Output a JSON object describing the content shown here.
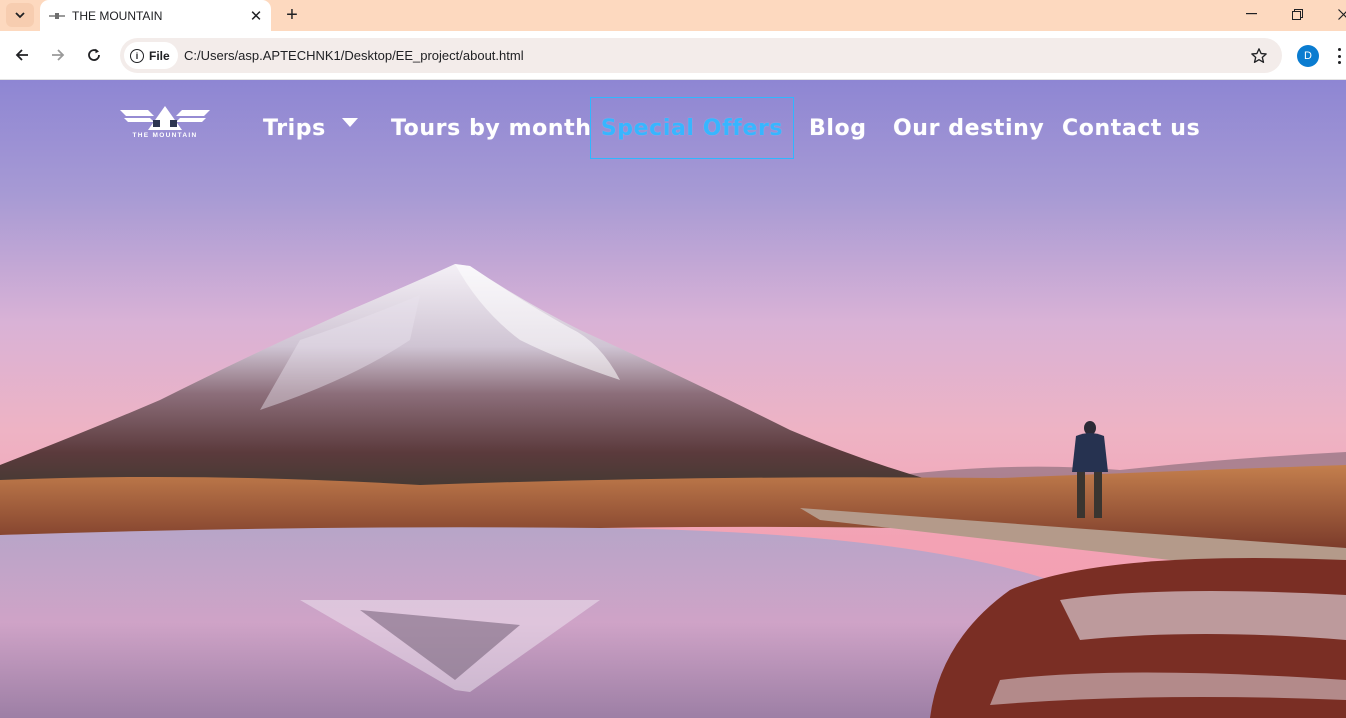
{
  "browser": {
    "tab_title": "THE MOUNTAIN",
    "tab_close": "✕",
    "new_tab": "+",
    "address_chip": "File",
    "url": "C:/Users/asp.APTECHNK1/Desktop/EE_project/about.html",
    "profile_initial": "D"
  },
  "site": {
    "logo_text": "THE MOUNTAIN",
    "nav": {
      "trips": "Trips",
      "tours": "Tours by month",
      "offers": "Special Offers",
      "blog": "Blog",
      "destiny": "Our destiny",
      "contact": "Contact us"
    },
    "active_nav": "Special Offers",
    "accent_color": "#2fb7ff"
  },
  "icons": [
    "tab-search-icon",
    "close-icon",
    "plus-icon",
    "minimize-icon",
    "restore-icon",
    "back-arrow-icon",
    "forward-arrow-icon",
    "reload-icon",
    "info-icon",
    "star-icon",
    "kebab-menu-icon",
    "caret-down-icon"
  ]
}
